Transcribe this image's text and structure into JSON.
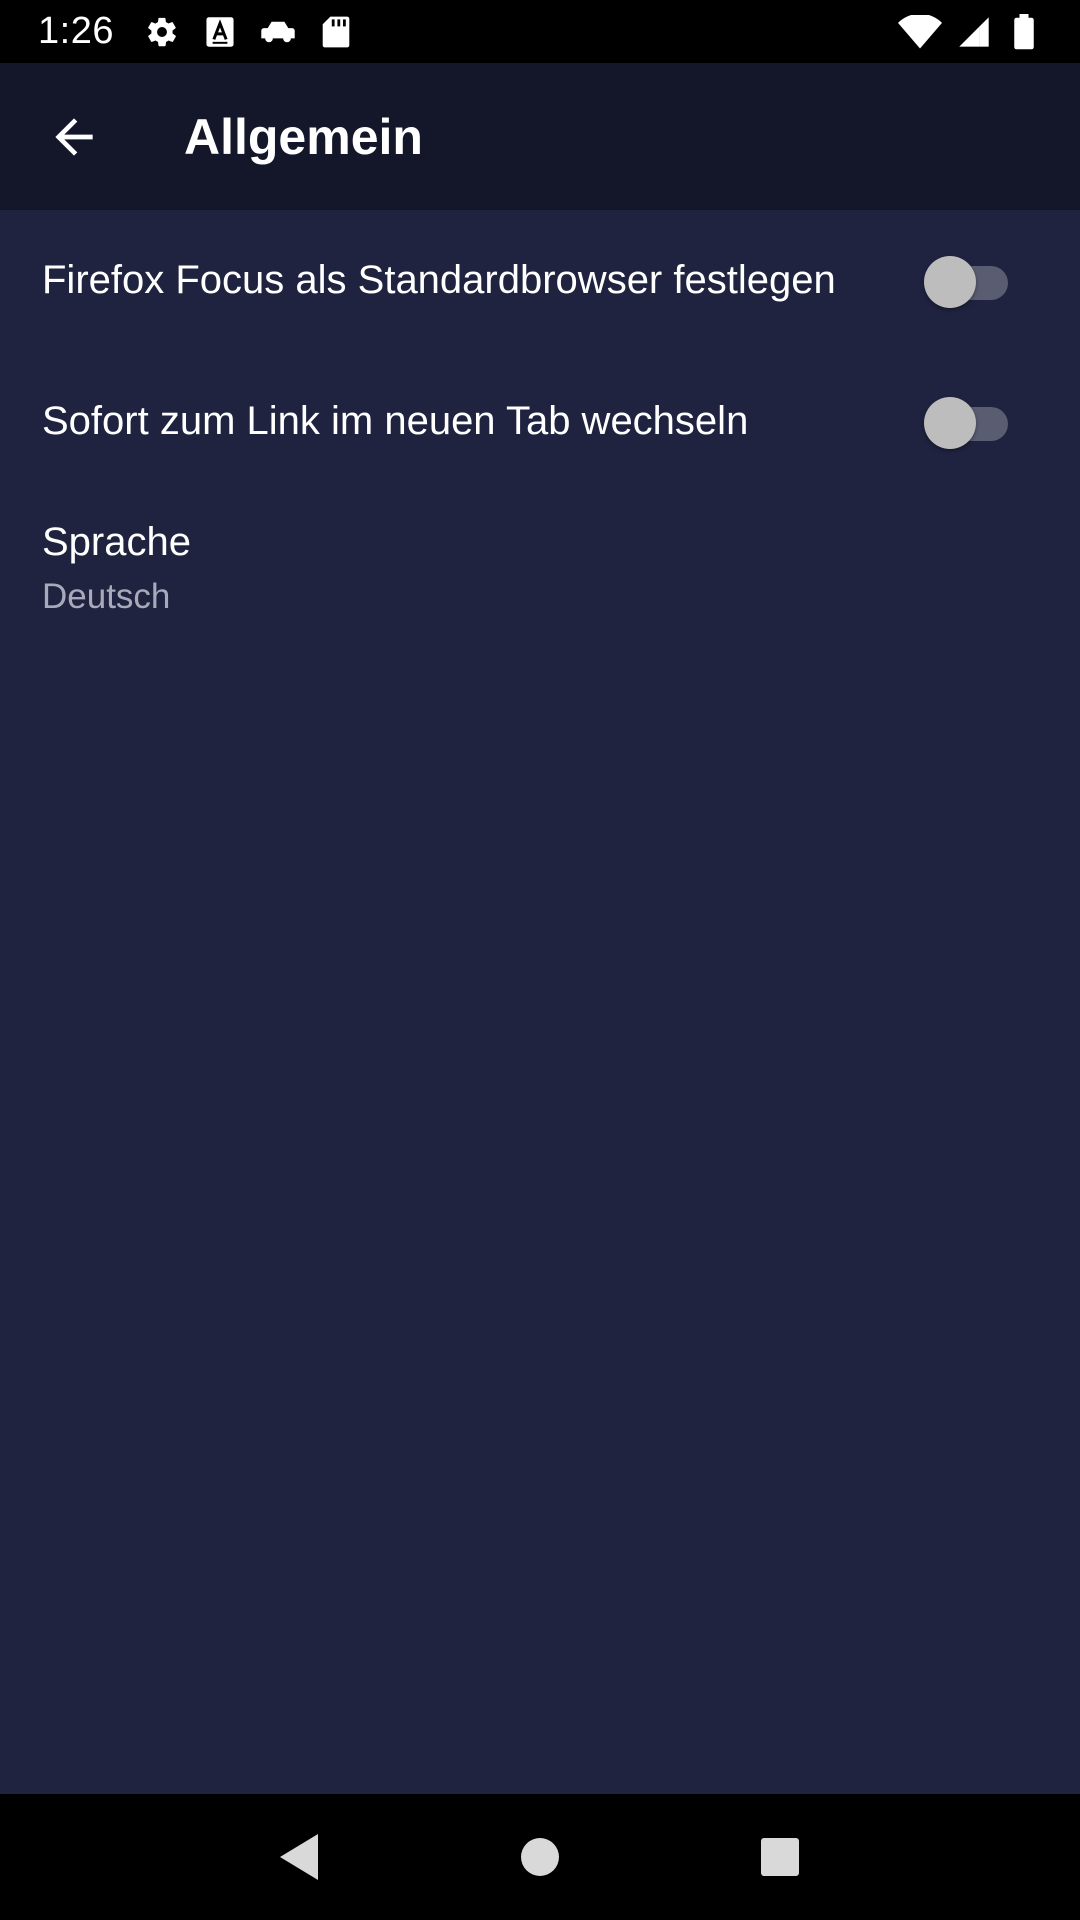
{
  "status_bar": {
    "time": "1:26",
    "left_icons": [
      "gear-icon",
      "font-icon",
      "car-icon",
      "sd-card-icon"
    ],
    "right_icons": [
      "wifi-icon",
      "signal-icon",
      "battery-icon"
    ]
  },
  "app_bar": {
    "back_icon": "arrow-back-icon",
    "title": "Allgemein"
  },
  "settings": {
    "default_browser": {
      "label": "Firefox Focus als Standardbrowser festlegen",
      "enabled": false
    },
    "switch_to_new_tab": {
      "label": "Sofort zum Link im neuen Tab wechseln",
      "enabled": false
    },
    "language": {
      "title": "Sprache",
      "value": "Deutsch"
    }
  },
  "nav_bar": {
    "buttons": [
      "nav-back-icon",
      "nav-home-icon",
      "nav-recents-icon"
    ]
  },
  "colors": {
    "background": "#202340",
    "app_bar": "#14162a",
    "text_primary": "#ffffff",
    "text_secondary": "#a8aabb",
    "toggle_track": "#5a5c71",
    "toggle_thumb": "#bdbdbd"
  }
}
